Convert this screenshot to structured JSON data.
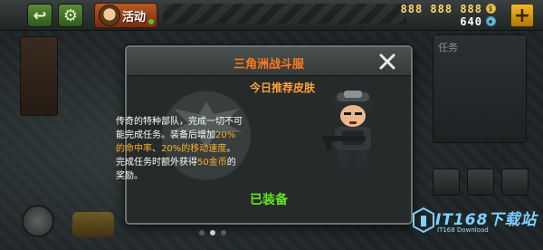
{
  "top_bar": {
    "activity_label": "活动",
    "gold_value": "888 888 888",
    "gem_value": "640",
    "gold_icon": "coin-icon",
    "gem_icon": "gem-icon"
  },
  "dialog": {
    "title": "三角洲战斗服",
    "subtitle": "今日推荐皮肤",
    "desc_parts": {
      "p1": "传奇的特种部队，完成一切不可能完成任务。装备后增加",
      "h1": "20%的命中率",
      "p2": "、",
      "h2": "20%的移动速度",
      "p3": "。完成任务时额外获得",
      "h3": "50金币",
      "p4": "的奖励。"
    },
    "status": "已装备"
  },
  "side_right": {
    "title": "任务"
  },
  "watermark": {
    "main": "IT168下载站",
    "sub": "IT168 Download"
  },
  "colors": {
    "title": "#ff7a1a",
    "subtitle": "#ffa23a",
    "highlight": "#ffae2a",
    "equipped": "#64e61e"
  }
}
